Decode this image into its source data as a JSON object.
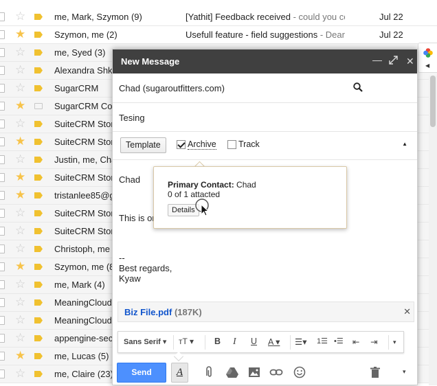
{
  "inbox": {
    "rows": [
      {
        "sender": "me, Mark, Szymon (9)",
        "subject": "[Yathit] Feedback received",
        "snippet": " - could you co",
        "date": "Jul 22",
        "starred": false,
        "tag": true,
        "unread": true
      },
      {
        "sender": "Szymon, me (2)",
        "subject": "Usefull feature - field suggestions",
        "snippet": " - Dear",
        "date": "Jul 22",
        "starred": true,
        "tag": true,
        "unread": true
      },
      {
        "sender": "me, Syed (3)",
        "subject": "",
        "snippet": "",
        "date": "",
        "starred": false,
        "tag": true,
        "unread": false
      },
      {
        "sender": "Alexandra Shk",
        "subject": "",
        "snippet": "",
        "date": "",
        "starred": false,
        "tag": true,
        "unread": false
      },
      {
        "sender": "SugarCRM",
        "subject": "",
        "snippet": "",
        "date": "",
        "starred": false,
        "tag": true,
        "unread": false
      },
      {
        "sender": "SugarCRM Co",
        "subject": "",
        "snippet": "",
        "date": "",
        "starred": true,
        "tag": false,
        "unread": false
      },
      {
        "sender": "SuiteCRM Stor",
        "subject": "",
        "snippet": "",
        "date": "",
        "starred": false,
        "tag": true,
        "unread": false
      },
      {
        "sender": "SuiteCRM Stor",
        "subject": "",
        "snippet": "",
        "date": "",
        "starred": true,
        "tag": true,
        "unread": false
      },
      {
        "sender": "Justin, me, Cha",
        "subject": "",
        "snippet": "",
        "date": "",
        "starred": false,
        "tag": true,
        "unread": false
      },
      {
        "sender": "SuiteCRM Stor",
        "subject": "",
        "snippet": "",
        "date": "",
        "starred": true,
        "tag": true,
        "unread": false
      },
      {
        "sender": "tristanlee85@g",
        "subject": "",
        "snippet": "",
        "date": "",
        "starred": true,
        "tag": true,
        "unread": false
      },
      {
        "sender": "SuiteCRM Stor",
        "subject": "",
        "snippet": "",
        "date": "",
        "starred": false,
        "tag": true,
        "unread": false
      },
      {
        "sender": "SuiteCRM Stor",
        "subject": "",
        "snippet": "",
        "date": "",
        "starred": false,
        "tag": true,
        "unread": false
      },
      {
        "sender": "Christoph, me",
        "subject": "",
        "snippet": "",
        "date": "",
        "starred": false,
        "tag": true,
        "unread": false
      },
      {
        "sender": "Szymon, me (8",
        "subject": "",
        "snippet": "",
        "date": "",
        "starred": true,
        "tag": true,
        "unread": false
      },
      {
        "sender": "me, Mark (4)",
        "subject": "",
        "snippet": "",
        "date": "",
        "starred": false,
        "tag": true,
        "unread": false
      },
      {
        "sender": "MeaningCloud",
        "subject": "",
        "snippet": "",
        "date": "",
        "starred": false,
        "tag": true,
        "unread": false
      },
      {
        "sender": "MeaningCloud",
        "subject": "",
        "snippet": "",
        "date": "",
        "starred": false,
        "tag": true,
        "unread": false
      },
      {
        "sender": "appengine-sec",
        "subject": "",
        "snippet": "",
        "date": "",
        "starred": false,
        "tag": true,
        "unread": false
      },
      {
        "sender": "me, Lucas (5)",
        "subject": "",
        "snippet": "",
        "date": "",
        "starred": true,
        "tag": true,
        "unread": false
      },
      {
        "sender": "me, Claire (23)",
        "subject": "",
        "snippet": "",
        "date": "",
        "starred": false,
        "tag": true,
        "unread": false
      }
    ]
  },
  "compose": {
    "title": "New Message",
    "to": "Chad (sugaroutfitters.com)",
    "subject": "Tesing",
    "crm": {
      "template_label": "Template",
      "archive_label": "Archive",
      "archive_checked": true,
      "track_label": "Track",
      "track_checked": false
    },
    "body": {
      "greeting": "Chad",
      "line1": "This is or",
      "sig_dash": "--",
      "sig_regards": "Best regards,",
      "sig_name": "Kyaw"
    },
    "attachment": {
      "name": "Biz File.pdf",
      "size": "(187K)"
    },
    "format": {
      "font": "Sans Serif"
    },
    "send_label": "Send"
  },
  "popup": {
    "contact_label": "Primary Contact:",
    "contact_name": "Chad",
    "count_text": "0 of 1 attacted",
    "details_label": "Details"
  },
  "colors": {
    "header": "#404040",
    "send": "#4d90fe",
    "star_on": "#f7c34a",
    "tag": "#f0c130",
    "link": "#1155cc"
  }
}
